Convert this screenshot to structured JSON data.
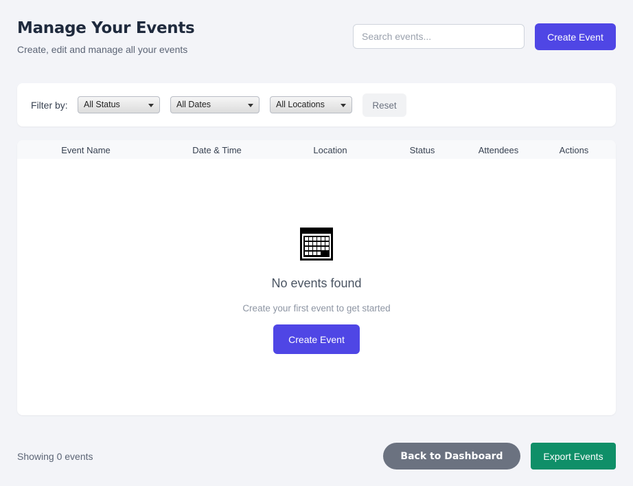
{
  "header": {
    "title": "Manage Your Events",
    "subtitle": "Create, edit and manage all your events",
    "search_placeholder": "Search events...",
    "create_label": "Create Event"
  },
  "filters": {
    "label": "Filter by:",
    "status": "All Status",
    "dates": "All Dates",
    "locations": "All Locations",
    "reset_label": "Reset"
  },
  "table": {
    "columns": [
      "Event Name",
      "Date & Time",
      "Location",
      "Status",
      "Attendees",
      "Actions"
    ],
    "rows": []
  },
  "empty_state": {
    "icon": "calendar-icon",
    "title": "No events found",
    "subtitle": "Create your first event to get started",
    "create_label": "Create Event"
  },
  "footer": {
    "showing_text": "Showing 0 events",
    "back_label": "Back to Dashboard",
    "export_label": "Export Events"
  },
  "colors": {
    "primary": "#4f46e5",
    "secondary": "#6b7280",
    "success": "#0f8f68",
    "background": "#f3f4f8"
  }
}
